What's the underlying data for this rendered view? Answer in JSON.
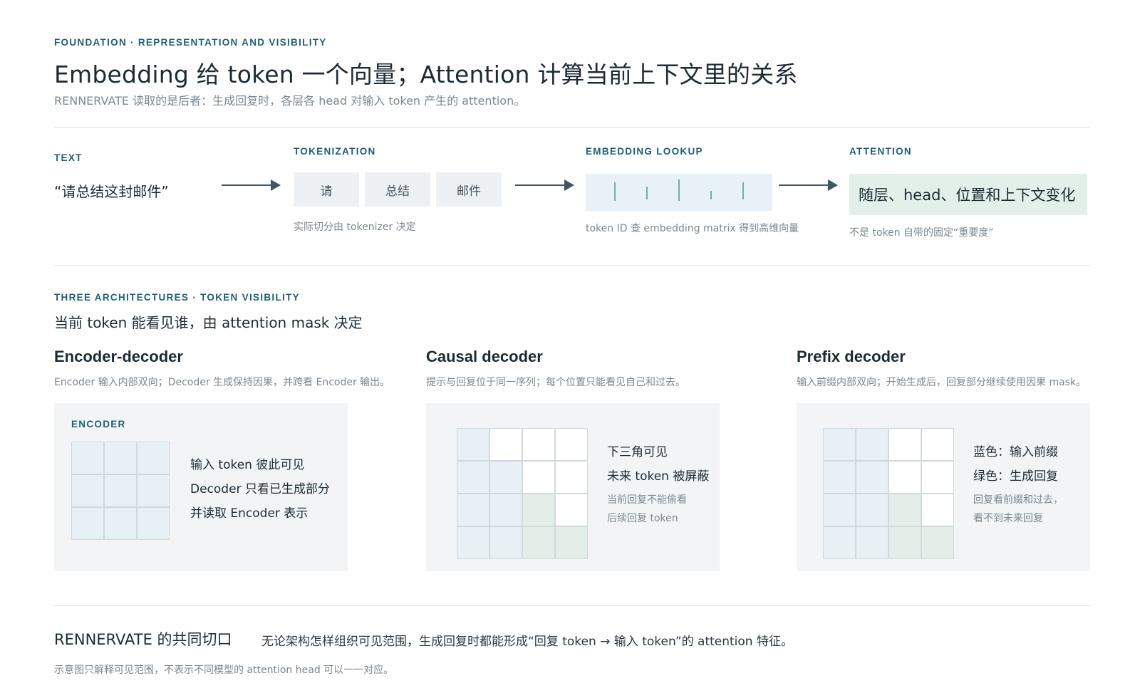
{
  "header": {
    "kicker": "FOUNDATION · REPRESENTATION AND VISIBILITY",
    "title": "Embedding 给 token 一个向量；Attention 计算当前上下文里的关系",
    "subtitle": "RENNERVATE 读取的是后者：生成回复时，各层各 head 对输入 token 产生的 attention。"
  },
  "pipeline": {
    "text": {
      "label": "TEXT",
      "sample": "“请总结这封邮件”"
    },
    "tokenization": {
      "label": "TOKENIZATION",
      "tokens": [
        "请",
        "总结",
        "邮件"
      ],
      "note": "实际切分由 tokenizer 决定"
    },
    "embedding": {
      "label": "EMBEDDING LOOKUP",
      "note": "token ID 查 embedding matrix 得到高维向量"
    },
    "attention": {
      "label": "ATTENTION",
      "box": "随层、head、位置和上下文变化",
      "note": "不是 token 自带的固定“重要度”"
    }
  },
  "architectures": {
    "kicker": "THREE ARCHITECTURES · TOKEN VISIBILITY",
    "subtitle": "当前 token 能看见谁，由 attention mask 决定",
    "encoder_decoder": {
      "title": "Encoder-decoder",
      "desc": "Encoder 输入内部双向；Decoder 生成保持因果，并跨看 Encoder 输出。",
      "panel_label": "ENCODER",
      "lines": [
        "输入 token 彼此可见",
        "Decoder 只看已生成部分",
        "并读取 Encoder 表示"
      ],
      "mask": [
        [
          "b",
          "b",
          "b"
        ],
        [
          "b",
          "b",
          "b"
        ],
        [
          "b",
          "b",
          "b"
        ]
      ]
    },
    "causal_decoder": {
      "title": "Causal decoder",
      "desc": "提示与回复位于同一序列；每个位置只能看见自己和过去。",
      "lines": [
        "下三角可见",
        "未来 token 被屏蔽"
      ],
      "small_lines": [
        "当前回复不能偷看",
        "后续回复 token"
      ],
      "mask": [
        [
          "b",
          "w",
          "w",
          "w"
        ],
        [
          "b",
          "b",
          "w",
          "w"
        ],
        [
          "b",
          "b",
          "g",
          "w"
        ],
        [
          "b",
          "b",
          "g",
          "g"
        ]
      ]
    },
    "prefix_decoder": {
      "title": "Prefix decoder",
      "desc": "输入前缀内部双向；开始生成后，回复部分继续使用因果 mask。",
      "lines": [
        "蓝色：输入前缀",
        "绿色：生成回复"
      ],
      "small_lines": [
        "回复看前缀和过去，",
        "看不到未来回复"
      ],
      "mask": [
        [
          "b",
          "b",
          "w",
          "w"
        ],
        [
          "b",
          "b",
          "w",
          "w"
        ],
        [
          "b",
          "b",
          "g",
          "w"
        ],
        [
          "b",
          "b",
          "g",
          "g"
        ]
      ]
    }
  },
  "footer": {
    "title": "RENNERVATE 的共同切口",
    "body": "无论架构怎样组织可见范围，生成回复时都能形成“回复 token → 输入 token”的 attention 特征。",
    "note": "示意图只解释可见范围，不表示不同模型的 attention head 可以一一对应。"
  },
  "colors": {
    "accent": "#1f5f73",
    "prefix_blue": "#e6f0f5",
    "reply_green": "#e4eee8",
    "panel": "#f2f4f5"
  }
}
